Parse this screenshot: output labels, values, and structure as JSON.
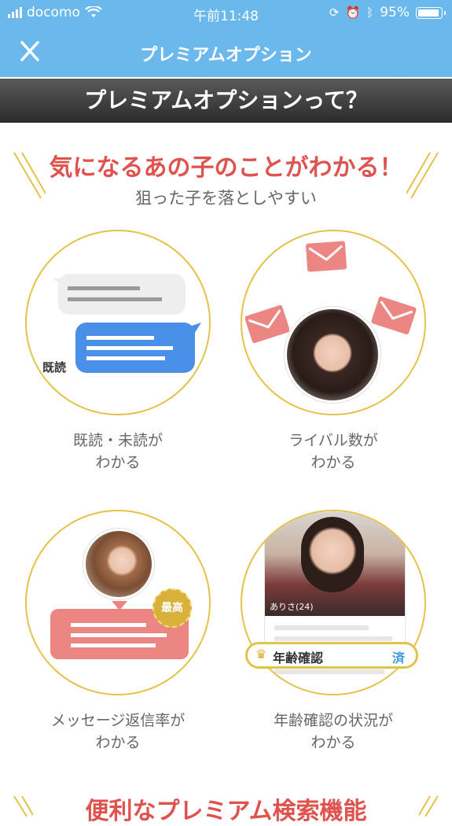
{
  "status_bar": {
    "carrier": "docomo",
    "time": "午前11:48",
    "battery": "95%",
    "battery_level": 0.95
  },
  "nav": {
    "title": "プレミアムオプション"
  },
  "banner": {
    "text": "プレミアムオプションって？"
  },
  "section1": {
    "heading": "気になるあの子のことがわかる！",
    "subheading": "狙った子を落としやすい",
    "features": [
      {
        "line1": "既読・未読が",
        "line2": "わかる",
        "badge": "既読"
      },
      {
        "line1": "ライバル数が",
        "line2": "わかる"
      },
      {
        "line1": "メッセージ返信率が",
        "line2": "わかる",
        "badge": "最高"
      },
      {
        "line1": "年齢確認の状況が",
        "line2": "わかる",
        "profile_name": "ありさ(24)",
        "verify_label": "年齢確認",
        "verify_status": "済"
      }
    ]
  },
  "section2": {
    "heading": "便利なプレミアム検索機能"
  },
  "colors": {
    "brand_blue": "#6ab8ec",
    "accent_red": "#e0524e",
    "gold": "#e4c24a",
    "bubble_blue": "#4a8fea",
    "envelope": "#ec8683"
  }
}
